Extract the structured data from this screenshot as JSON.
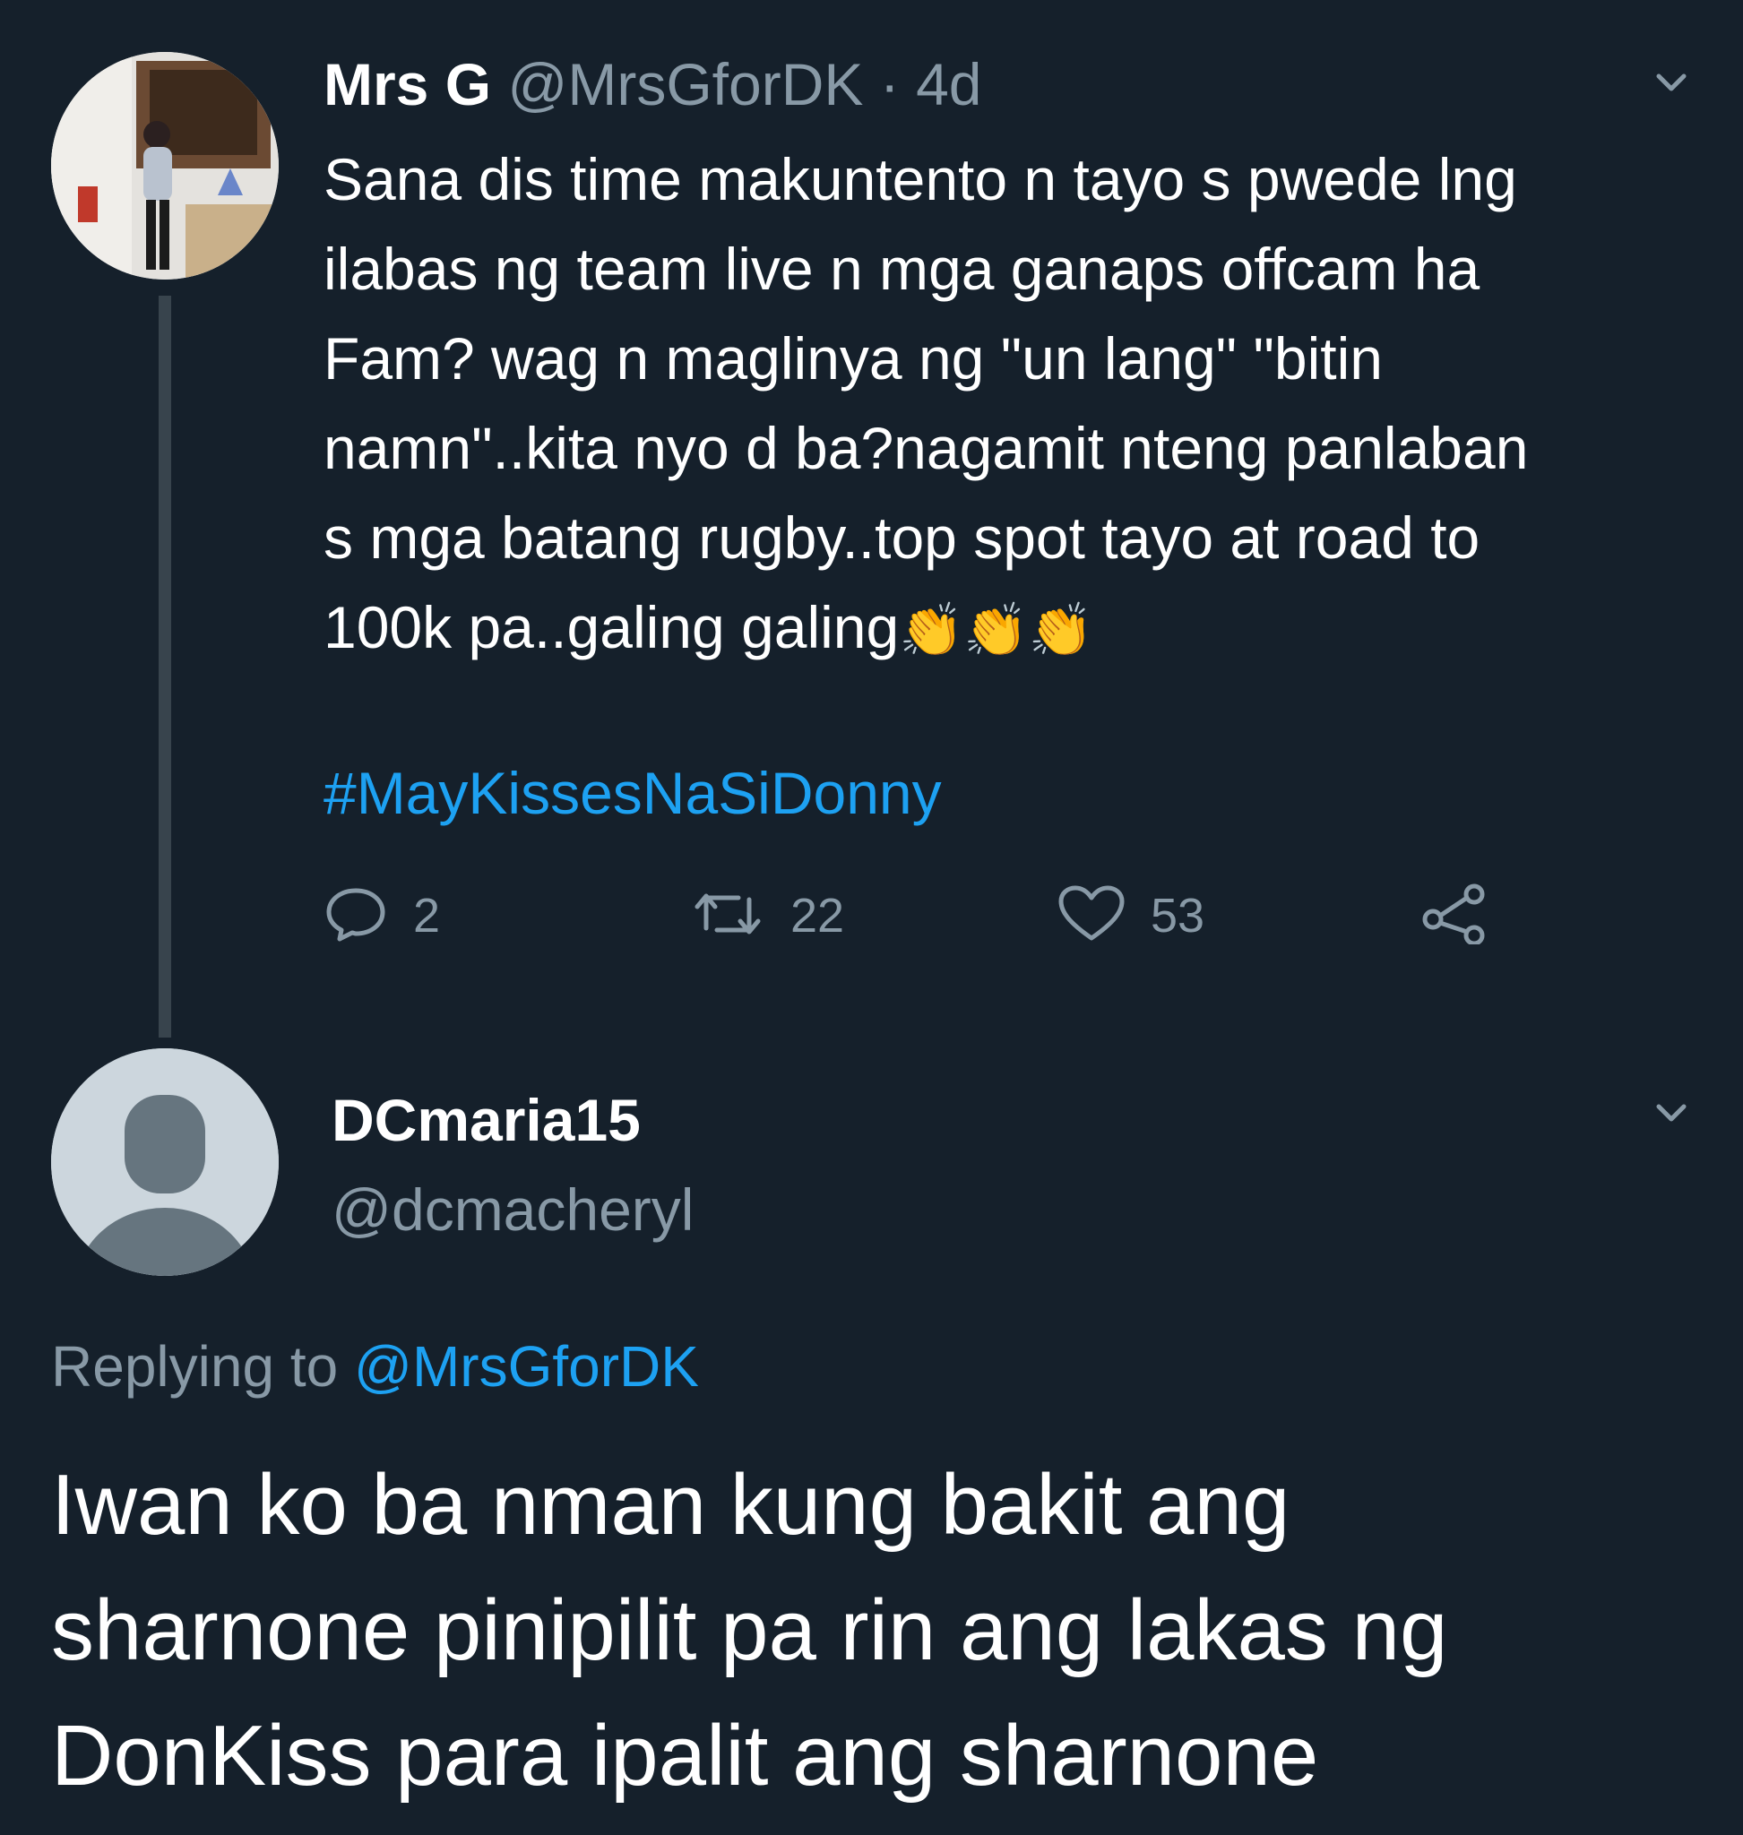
{
  "tweet": {
    "author_name": "Mrs G",
    "author_handle": "@MrsGforDK",
    "separator": "·",
    "time": "4d",
    "text_lines": [
      "Sana dis time makuntento n tayo s pwede lng",
      "ilabas ng team live n mga ganaps offcam ha",
      "Fam? wag n maglinya ng \"un lang\" \"bitin",
      "namn\"..kita nyo d ba?nagamit nteng panlaban",
      "s mga batang rugby..top spot tayo at road to",
      "100k pa..galing galing"
    ],
    "emoji": "👏👏👏",
    "hashtag": "#MayKissesNaSiDonny",
    "reply_count": "2",
    "retweet_count": "22",
    "like_count": "53"
  },
  "reply": {
    "author_name": "DCmaria15",
    "author_handle": "@dcmacheryl",
    "replying_label": "Replying to",
    "replying_to": "@MrsGforDK",
    "text_lines": [
      "Iwan ko ba nman kung bakit ang",
      "sharnone pinipilit pa rin ang lakas ng",
      "DonKiss para ipalit ang sharnone"
    ]
  },
  "icons": {
    "reply": "reply-icon",
    "retweet": "retweet-icon",
    "like": "heart-icon",
    "share": "share-icon",
    "menu": "chevron-down-icon"
  },
  "colors": {
    "background": "#15202b",
    "accent": "#1da1f2",
    "secondary_text": "#8899a6",
    "thread_line": "#38444d"
  }
}
